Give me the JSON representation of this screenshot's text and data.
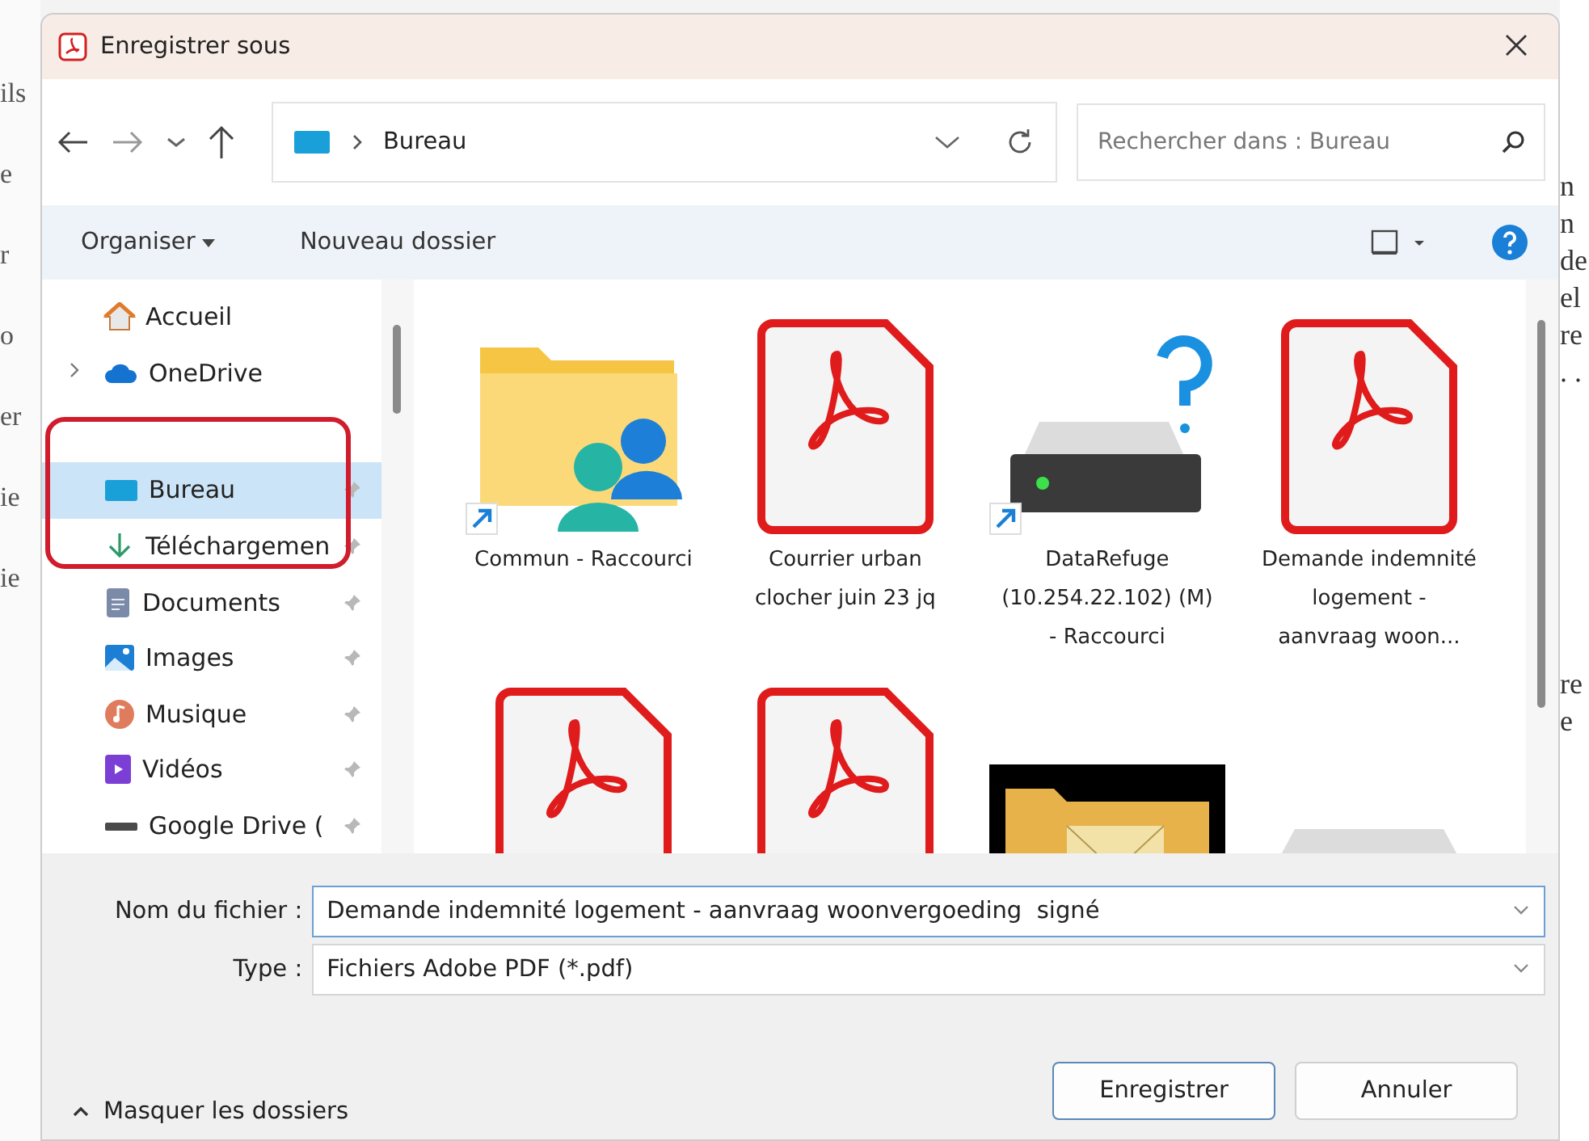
{
  "background": {
    "left_fragments": [
      "ils",
      "e",
      "r",
      "o",
      "er",
      "ie",
      "ie"
    ],
    "right_fragments": [
      "n",
      "n",
      "de",
      "el",
      "re",
      ". .",
      "re",
      "e"
    ]
  },
  "window": {
    "title": "Enregistrer sous"
  },
  "address": {
    "path": "Bureau"
  },
  "search": {
    "placeholder": "Rechercher dans : Bureau"
  },
  "toolbar": {
    "organize": "Organiser",
    "new_folder": "Nouveau dossier"
  },
  "sidebar": {
    "items": [
      {
        "label": "Accueil",
        "kind": "home",
        "expandable": false,
        "pinned": false,
        "selected": false
      },
      {
        "label": "OneDrive",
        "kind": "cloud",
        "expandable": true,
        "pinned": false,
        "selected": false
      },
      {
        "label": "Bureau",
        "kind": "desktop",
        "expandable": false,
        "pinned": true,
        "selected": true
      },
      {
        "label": "Téléchargemen",
        "kind": "download",
        "expandable": false,
        "pinned": true,
        "selected": false
      },
      {
        "label": "Documents",
        "kind": "documents",
        "expandable": false,
        "pinned": true,
        "selected": false
      },
      {
        "label": "Images",
        "kind": "images",
        "expandable": false,
        "pinned": true,
        "selected": false
      },
      {
        "label": "Musique",
        "kind": "music",
        "expandable": false,
        "pinned": true,
        "selected": false
      },
      {
        "label": "Vidéos",
        "kind": "videos",
        "expandable": false,
        "pinned": true,
        "selected": false
      },
      {
        "label": "Google Drive (",
        "kind": "drive",
        "expandable": false,
        "pinned": true,
        "selected": false
      }
    ]
  },
  "files": [
    {
      "label": "Commun - Raccourci",
      "kind": "shared-folder",
      "shortcut": true
    },
    {
      "label": "Courrier urban clocher juin 23 jq",
      "kind": "pdf",
      "shortcut": false
    },
    {
      "label": "DataRefuge (10.254.22.102) (M) - Raccourci",
      "kind": "network-drive",
      "shortcut": true
    },
    {
      "label": "Demande indemnité logement - aanvraag woon...",
      "kind": "pdf",
      "shortcut": false
    },
    {
      "kind": "pdf"
    },
    {
      "kind": "pdf"
    },
    {
      "kind": "mail-folder"
    },
    {
      "kind": "drive"
    }
  ],
  "form": {
    "filename_label": "Nom du fichier :",
    "filename": "Demande indemnité logement - aanvraag woonvergoeding  signé",
    "type_label": "Type :",
    "type": "Fichiers Adobe PDF (*.pdf)"
  },
  "footer": {
    "toggle": "Masquer les dossiers",
    "buttons": [
      {
        "label": "Enregistrer",
        "default": true
      },
      {
        "label": "Annuler",
        "default": false
      }
    ]
  }
}
